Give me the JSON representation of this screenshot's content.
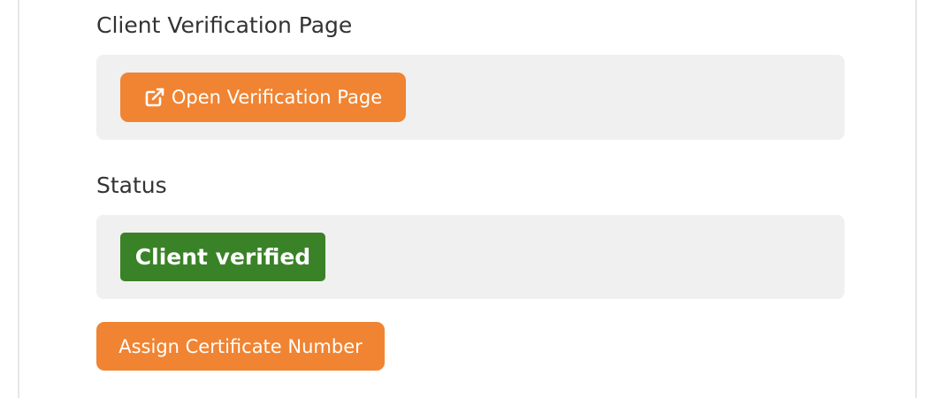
{
  "verification": {
    "title": "Client Verification Page",
    "open_button_label": "Open Verification Page",
    "open_button_icon": "external-link-icon"
  },
  "status": {
    "title": "Status",
    "badge_text": "Client verified",
    "badge_color": "#3a8227"
  },
  "actions": {
    "assign_button_label": "Assign Certificate Number"
  },
  "colors": {
    "accent": "#f08432",
    "panel_background": "#f0f0f0"
  }
}
